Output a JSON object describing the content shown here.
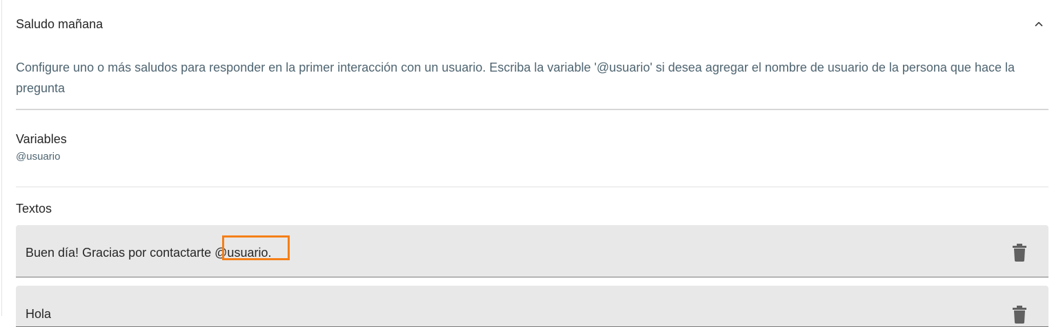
{
  "panel": {
    "title": "Saludo mañana",
    "expanded": true,
    "description": "Configure uno o más saludos para responder en la primer interacción con un usuario. Escriba la variable '@usuario' si desea agregar el nombre de usuario de la persona que hace la pregunta"
  },
  "variables": {
    "heading": "Variables",
    "items": [
      "@usuario"
    ]
  },
  "texts": {
    "heading": "Textos",
    "items": [
      {
        "prefix": "Buen día! Gracias por contactarte ",
        "variable": "@usuario",
        "suffix": "."
      },
      {
        "prefix": "Hola",
        "variable": "",
        "suffix": ""
      }
    ]
  },
  "colors": {
    "highlight": "#f57f17",
    "row_bg": "#e8e8e8",
    "description_text": "#4e6470",
    "icon": "#616161"
  },
  "icons": {
    "collapse": "chevron-up-icon",
    "delete": "trash-icon"
  }
}
